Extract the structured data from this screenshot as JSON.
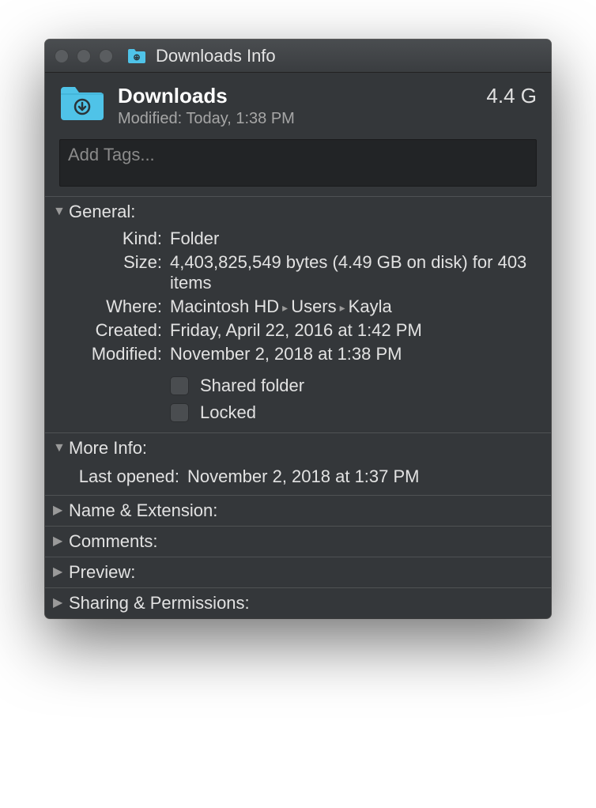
{
  "titlebar": {
    "title": "Downloads Info"
  },
  "header": {
    "name": "Downloads",
    "modified_label": "Modified:",
    "modified_value": "Today, 1:38 PM",
    "size": "4.4 G"
  },
  "tags": {
    "placeholder": "Add Tags..."
  },
  "sections": {
    "general": {
      "title": "General:",
      "kind_label": "Kind:",
      "kind_value": "Folder",
      "size_label": "Size:",
      "size_value": "4,403,825,549 bytes (4.49 GB on disk) for 403 items",
      "where_label": "Where:",
      "where_parts": [
        "Macintosh HD",
        "Users",
        "Kayla"
      ],
      "created_label": "Created:",
      "created_value": "Friday, April 22, 2016 at 1:42 PM",
      "modified_label": "Modified:",
      "modified_value": "November 2, 2018 at 1:38 PM",
      "shared_label": "Shared folder",
      "locked_label": "Locked"
    },
    "more_info": {
      "title": "More Info:",
      "last_opened_label": "Last opened:",
      "last_opened_value": "November 2, 2018 at 1:37 PM"
    },
    "name_ext": {
      "title": "Name & Extension:"
    },
    "comments": {
      "title": "Comments:"
    },
    "preview": {
      "title": "Preview:"
    },
    "sharing": {
      "title": "Sharing & Permissions:"
    }
  }
}
